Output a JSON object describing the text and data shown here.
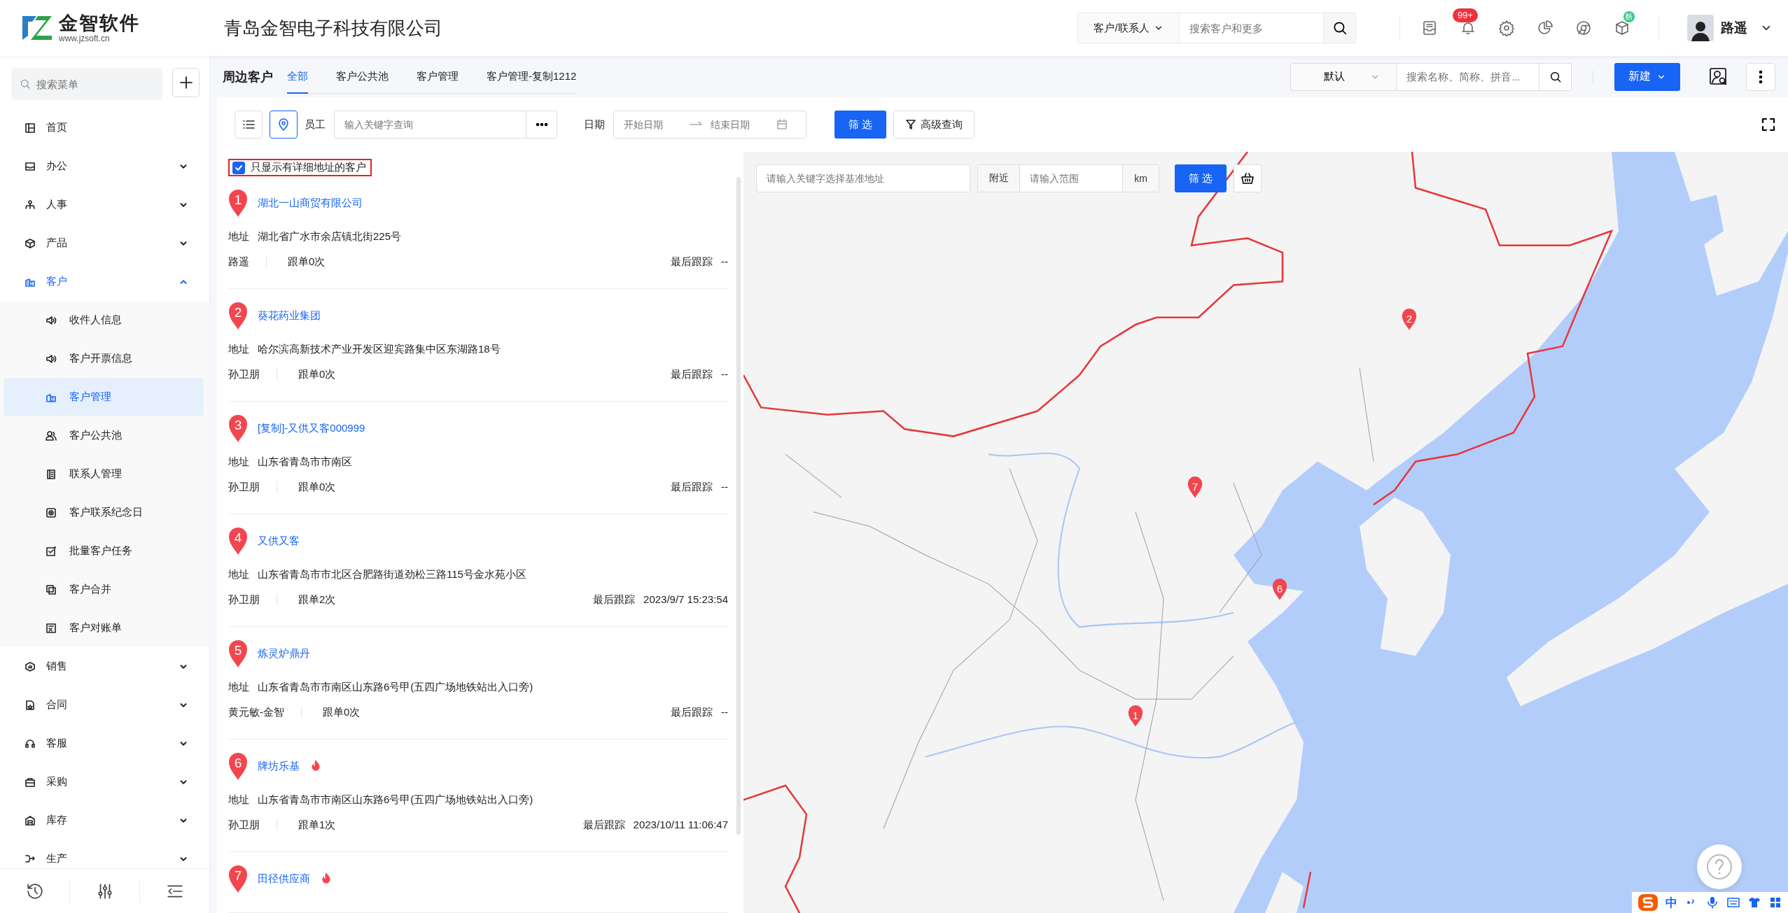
{
  "header": {
    "logo": {
      "name": "金智软件",
      "url": "www.jzsoft.cn"
    },
    "company": "青岛金智电子科技有限公司",
    "search": {
      "scope": "客户/联系人",
      "placeholder": "搜索客户和更多"
    },
    "notification_badge": "99+",
    "app_badge": "酷",
    "user": "路遥"
  },
  "sidebar": {
    "search": {
      "placeholder": "搜索菜单"
    },
    "items": [
      {
        "label": "首页",
        "selected": false
      },
      {
        "label": "办公",
        "selected": false,
        "expanded": false
      },
      {
        "label": "人事",
        "selected": false,
        "expanded": false
      },
      {
        "label": "产品",
        "selected": false,
        "expanded": false
      },
      {
        "label": "客户",
        "selected": true,
        "expanded": true,
        "children": [
          {
            "label": "收件人信息",
            "selected": false
          },
          {
            "label": "客户开票信息",
            "selected": false
          },
          {
            "label": "客户管理",
            "selected": true
          },
          {
            "label": "客户公共池",
            "selected": false
          },
          {
            "label": "联系人管理",
            "selected": false
          },
          {
            "label": "客户联系纪念日",
            "selected": false
          },
          {
            "label": "批量客户任务",
            "selected": false
          },
          {
            "label": "客户合并",
            "selected": false
          },
          {
            "label": "客户对账单",
            "selected": false
          }
        ]
      },
      {
        "label": "销售",
        "selected": false,
        "expanded": false
      },
      {
        "label": "合同",
        "selected": false,
        "expanded": false
      },
      {
        "label": "客服",
        "selected": false,
        "expanded": false
      },
      {
        "label": "采购",
        "selected": false,
        "expanded": false
      },
      {
        "label": "库存",
        "selected": false,
        "expanded": false
      },
      {
        "label": "生产",
        "selected": false,
        "expanded": false
      }
    ]
  },
  "page": {
    "title": "周边客户",
    "tabs": [
      {
        "label": "全部",
        "selected": true
      },
      {
        "label": "客户公共池",
        "selected": false
      },
      {
        "label": "客户管理",
        "selected": false
      },
      {
        "label": "客户管理-复制1212",
        "selected": false
      }
    ],
    "view": "默认",
    "search_placeholder": "搜索名称、简称、拼音...",
    "new_button": "新建"
  },
  "filters": {
    "view_modes": [
      {
        "kind": "list",
        "selected": false
      },
      {
        "kind": "map",
        "selected": true
      }
    ],
    "employee": {
      "label": "员工",
      "placeholder": "输入关键字查询"
    },
    "date": {
      "label": "日期",
      "start_placeholder": "开始日期",
      "end_placeholder": "结束日期"
    },
    "filter_button": "筛 选",
    "advanced_button": "高级查询"
  },
  "address_only": {
    "label": "只显示有详细地址的客户",
    "checked": true
  },
  "customers": [
    {
      "number": "1",
      "name": "湖北一山商贸有限公司",
      "hot": false,
      "address_label": "地址",
      "address": "湖北省广水市余店镇北街225号",
      "owner": "路遥",
      "follow_count": "跟单0次",
      "last_follow_label": "最后跟踪",
      "last_follow": "--"
    },
    {
      "number": "2",
      "name": "葵花药业集团",
      "hot": false,
      "address_label": "地址",
      "address": "哈尔滨高新技术产业开发区迎宾路集中区东湖路18号",
      "owner": "孙卫朋",
      "follow_count": "跟单0次",
      "last_follow_label": "最后跟踪",
      "last_follow": "--"
    },
    {
      "number": "3",
      "name": "[复制]-又供又客000999",
      "hot": false,
      "address_label": "地址",
      "address": "山东省青岛市市南区",
      "owner": "孙卫朋",
      "follow_count": "跟单0次",
      "last_follow_label": "最后跟踪",
      "last_follow": "--"
    },
    {
      "number": "4",
      "name": "又供又客",
      "hot": false,
      "address_label": "地址",
      "address": "山东省青岛市市北区合肥路街道劲松三路115号金水苑小区",
      "owner": "孙卫朋",
      "follow_count": "跟单2次",
      "last_follow_label": "最后跟踪",
      "last_follow": "2023/9/7 15:23:54"
    },
    {
      "number": "5",
      "name": "炼灵炉鼎丹",
      "hot": false,
      "address_label": "地址",
      "address": "山东省青岛市市南区山东路6号甲(五四广场地铁站出入口旁)",
      "owner": "黄元敏-金智",
      "follow_count": "跟单0次",
      "last_follow_label": "最后跟踪",
      "last_follow": "--"
    },
    {
      "number": "6",
      "name": "牌坊乐基",
      "hot": true,
      "address_label": "地址",
      "address": "山东省青岛市市南区山东路6号甲(五四广场地铁站出入口旁)",
      "owner": "孙卫朋",
      "follow_count": "跟单1次",
      "last_follow_label": "最后跟踪",
      "last_follow": "2023/10/11 11:06:47"
    },
    {
      "number": "7",
      "name": "田径供应商",
      "hot": true
    }
  ],
  "map": {
    "search_placeholder": "请输入关键字选择基准地址",
    "nearby_label": "附近",
    "range_placeholder": "请输入范围",
    "unit": "km",
    "filter_button": "筛 选",
    "markers": [
      {
        "label": "1"
      },
      {
        "label": "2"
      },
      {
        "label": "6"
      },
      {
        "label": "7"
      }
    ]
  },
  "ime": {
    "mode": "中"
  }
}
